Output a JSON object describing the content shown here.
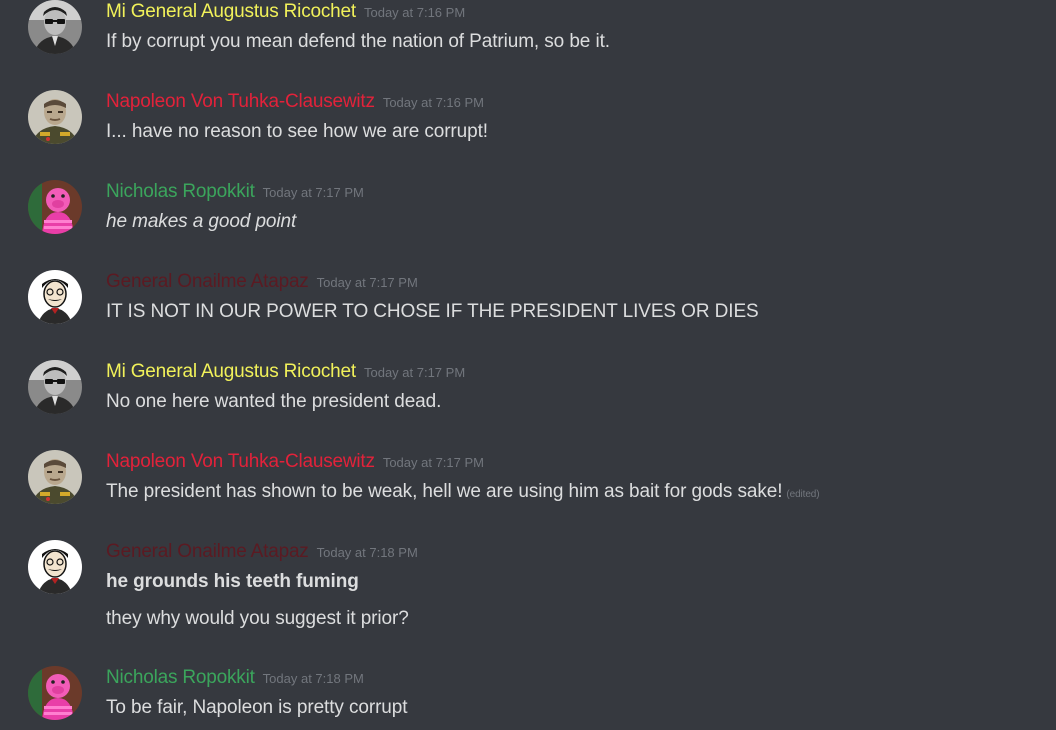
{
  "colors": {
    "background": "#36393f",
    "message_text": "#dcddde",
    "timestamp": "#72767d",
    "author_augustus": "#f1f15a",
    "author_napoleon": "#e2223a",
    "author_nicholas": "#3ba55c",
    "author_onailme": "#5b1a22"
  },
  "messages": [
    {
      "author": "Mi General Augustus Ricochet",
      "avatar_icon": "bw-man-with-glasses-avatar-icon",
      "timestamp": "Today at 7:16 PM",
      "lines": [
        "If by corrupt you mean defend the nation of Patrium, so be it."
      ]
    },
    {
      "author": "Napoleon Von Tuhka-Clausewitz",
      "avatar_icon": "uniformed-officer-avatar-icon",
      "timestamp": "Today at 7:16 PM",
      "lines": [
        "I... have no reason to see how we are corrupt!"
      ]
    },
    {
      "author": "Nicholas Ropokkit",
      "avatar_icon": "pink-pig-avatar-icon",
      "timestamp": "Today at 7:17 PM",
      "lines": [
        "he makes a good point"
      ]
    },
    {
      "author": "General Onailme Atapaz",
      "avatar_icon": "cartoon-mustache-man-avatar-icon",
      "timestamp": "Today at 7:17 PM",
      "lines": [
        "IT IS NOT IN OUR POWER TO CHOSE IF THE PRESIDENT LIVES OR DIES"
      ]
    },
    {
      "author": "Mi General Augustus Ricochet",
      "avatar_icon": "bw-man-with-glasses-avatar-icon",
      "timestamp": "Today at 7:17 PM",
      "lines": [
        "No one here wanted the president dead."
      ]
    },
    {
      "author": "Napoleon Von Tuhka-Clausewitz",
      "avatar_icon": "uniformed-officer-avatar-icon",
      "timestamp": "Today at 7:17 PM",
      "lines": [
        "The president has shown to be weak, hell we are using him as bait for gods sake!"
      ],
      "edited": "(edited)"
    },
    {
      "author": "General Onailme Atapaz",
      "avatar_icon": "cartoon-mustache-man-avatar-icon",
      "timestamp": "Today at 7:18 PM",
      "lines": [
        "he grounds his teeth fuming",
        "they why would you suggest it prior?"
      ]
    },
    {
      "author": "Nicholas Ropokkit",
      "avatar_icon": "pink-pig-avatar-icon",
      "timestamp": "Today at 7:18 PM",
      "lines": [
        "To be fair, Napoleon is pretty corrupt"
      ]
    }
  ]
}
